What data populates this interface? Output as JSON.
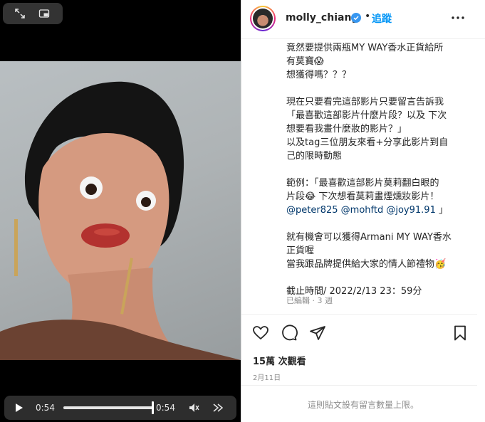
{
  "video": {
    "current_time": "0:54",
    "duration": "0:54",
    "progress": 1.0
  },
  "post": {
    "username": "molly_chiang",
    "dot": "•",
    "follow_label": "追蹤",
    "caption_lines": [
      "竟然要提供兩瓶MY WAY香水正貨給所",
      "有莫寶😱",
      "想獲得嗎？？？",
      "",
      "現在只要看完這部影片只要留言告訴我",
      "「最喜歡這部影片什麼片段？以及 下次",
      "想要看我畫什麼妝的影片？」",
      "以及tag三位朋友來看+分享此影片到自",
      "己的限時動態",
      "",
      "範例：「最喜歡這部影片莫莉翻白眼的",
      "片段😂 下次想看莫莉畫煙燻妝影片！"
    ],
    "mentions": [
      "@peter825",
      "@mohftd",
      "@joy91.91",
      "」"
    ],
    "caption_lines_2": [
      "",
      "就有機會可以獲得Armani MY WAY香水",
      "正貨喔",
      "當我跟品牌提供給大家的情人節禮物🥳",
      "",
      "截止時間/ 2022/2/13 23：59分"
    ],
    "edited_label": "已編輯 · 3 週",
    "views_label": "15萬 次觀看",
    "date_label": "2月11日",
    "comments_disabled": "這則貼文設有留言數量上限。"
  },
  "icons": {
    "expand": "expand-icon",
    "pip": "picture-in-picture-icon",
    "play": "play-icon",
    "mute": "muted-speaker-icon",
    "skip": "fast-forward-icon",
    "verified": "verified-badge-icon",
    "more": "more-options-icon",
    "like": "heart-icon",
    "comment": "comment-icon",
    "share": "share-icon",
    "save": "bookmark-icon"
  },
  "colors": {
    "accent": "#0095f6",
    "verified": "#3897f0",
    "text": "#262626",
    "muted": "#8e8e8e"
  }
}
